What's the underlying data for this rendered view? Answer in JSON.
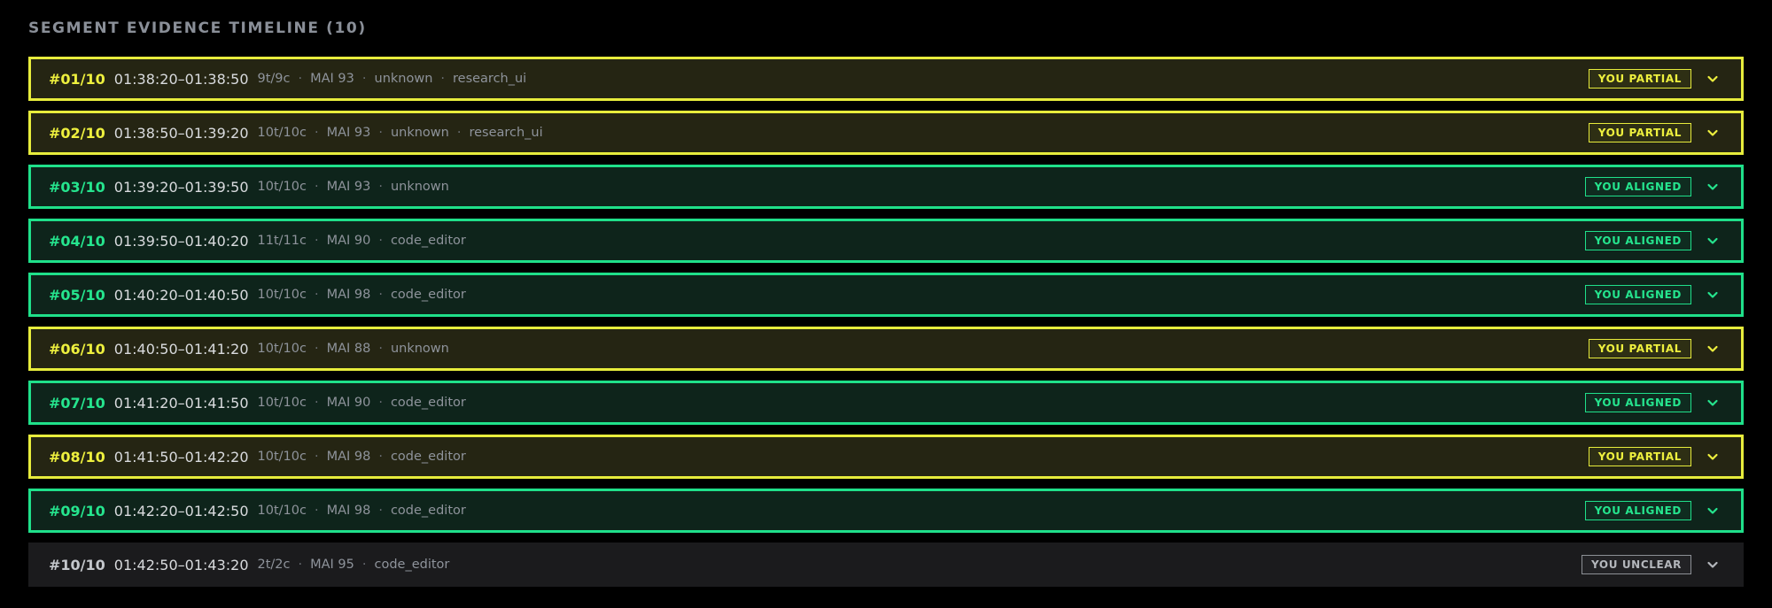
{
  "section": {
    "title": "SEGMENT EVIDENCE TIMELINE (10)"
  },
  "colors": {
    "background": "#000000",
    "partial_accent": "#e7ec3c",
    "aligned_accent": "#1fe08a",
    "unclear_accent": "#8d9096"
  },
  "segments": [
    {
      "id": "#01/10",
      "time": "01:38:20–01:38:50",
      "meta": [
        "9t/9c",
        "MAI 93",
        "unknown",
        "research_ui"
      ],
      "status": "partial",
      "badge": "YOU PARTIAL",
      "icon": "chevron-down-icon"
    },
    {
      "id": "#02/10",
      "time": "01:38:50–01:39:20",
      "meta": [
        "10t/10c",
        "MAI 93",
        "unknown",
        "research_ui"
      ],
      "status": "partial",
      "badge": "YOU PARTIAL",
      "icon": "chevron-down-icon"
    },
    {
      "id": "#03/10",
      "time": "01:39:20–01:39:50",
      "meta": [
        "10t/10c",
        "MAI 93",
        "unknown"
      ],
      "status": "aligned",
      "badge": "YOU ALIGNED",
      "icon": "chevron-down-icon"
    },
    {
      "id": "#04/10",
      "time": "01:39:50–01:40:20",
      "meta": [
        "11t/11c",
        "MAI 90",
        "code_editor"
      ],
      "status": "aligned",
      "badge": "YOU ALIGNED",
      "icon": "chevron-down-icon"
    },
    {
      "id": "#05/10",
      "time": "01:40:20–01:40:50",
      "meta": [
        "10t/10c",
        "MAI 98",
        "code_editor"
      ],
      "status": "aligned",
      "badge": "YOU ALIGNED",
      "icon": "chevron-down-icon"
    },
    {
      "id": "#06/10",
      "time": "01:40:50–01:41:20",
      "meta": [
        "10t/10c",
        "MAI 88",
        "unknown"
      ],
      "status": "partial",
      "badge": "YOU PARTIAL",
      "icon": "chevron-down-icon"
    },
    {
      "id": "#07/10",
      "time": "01:41:20–01:41:50",
      "meta": [
        "10t/10c",
        "MAI 90",
        "code_editor"
      ],
      "status": "aligned",
      "badge": "YOU ALIGNED",
      "icon": "chevron-down-icon"
    },
    {
      "id": "#08/10",
      "time": "01:41:50–01:42:20",
      "meta": [
        "10t/10c",
        "MAI 98",
        "code_editor"
      ],
      "status": "partial",
      "badge": "YOU PARTIAL",
      "icon": "chevron-down-icon"
    },
    {
      "id": "#09/10",
      "time": "01:42:20–01:42:50",
      "meta": [
        "10t/10c",
        "MAI 98",
        "code_editor"
      ],
      "status": "aligned",
      "badge": "YOU ALIGNED",
      "icon": "chevron-down-icon"
    },
    {
      "id": "#10/10",
      "time": "01:42:50–01:43:20",
      "meta": [
        "2t/2c",
        "MAI 95",
        "code_editor"
      ],
      "status": "unclear",
      "badge": "YOU UNCLEAR",
      "icon": "chevron-down-icon"
    }
  ]
}
